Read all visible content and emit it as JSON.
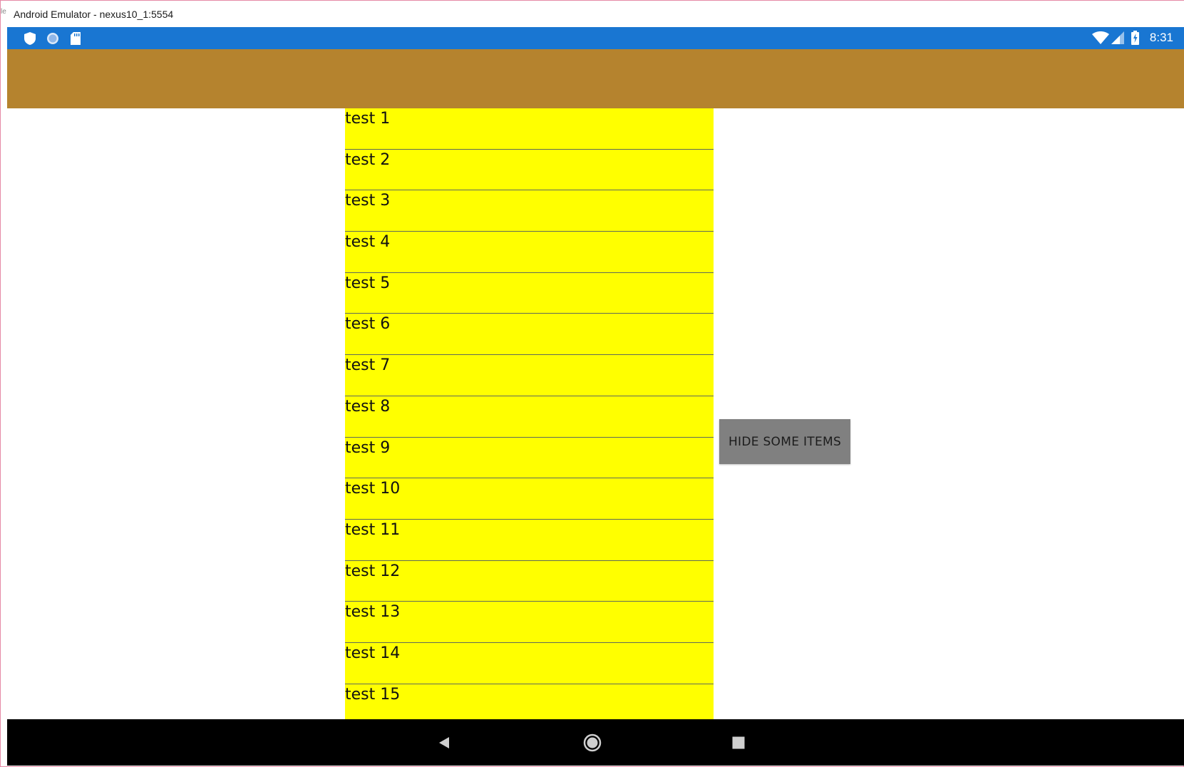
{
  "window": {
    "title": "Android Emulator - nexus10_1:5554",
    "edge_glyph": "le"
  },
  "status_bar": {
    "time": "8:31",
    "left_icons": [
      "shield-icon",
      "sync-circle-icon",
      "sd-card-icon"
    ],
    "right_icons": [
      "wifi-icon",
      "signal-icon",
      "battery-charging-icon"
    ]
  },
  "colors": {
    "status_bar": "#1976d2",
    "app_bar": "#b5832e",
    "list_background": "#ffff00",
    "button_background": "#808080",
    "nav_bar": "#000000"
  },
  "list": {
    "items": [
      "test 1",
      "test 2",
      "test 3",
      "test 4",
      "test 5",
      "test 6",
      "test 7",
      "test 8",
      "test 9",
      "test 10",
      "test 11",
      "test 12",
      "test 13",
      "test 14",
      "test 15"
    ]
  },
  "button": {
    "label": "HIDE SOME ITEMS"
  },
  "nav_bar": {
    "buttons": [
      "back-icon",
      "home-icon",
      "recents-icon"
    ]
  }
}
